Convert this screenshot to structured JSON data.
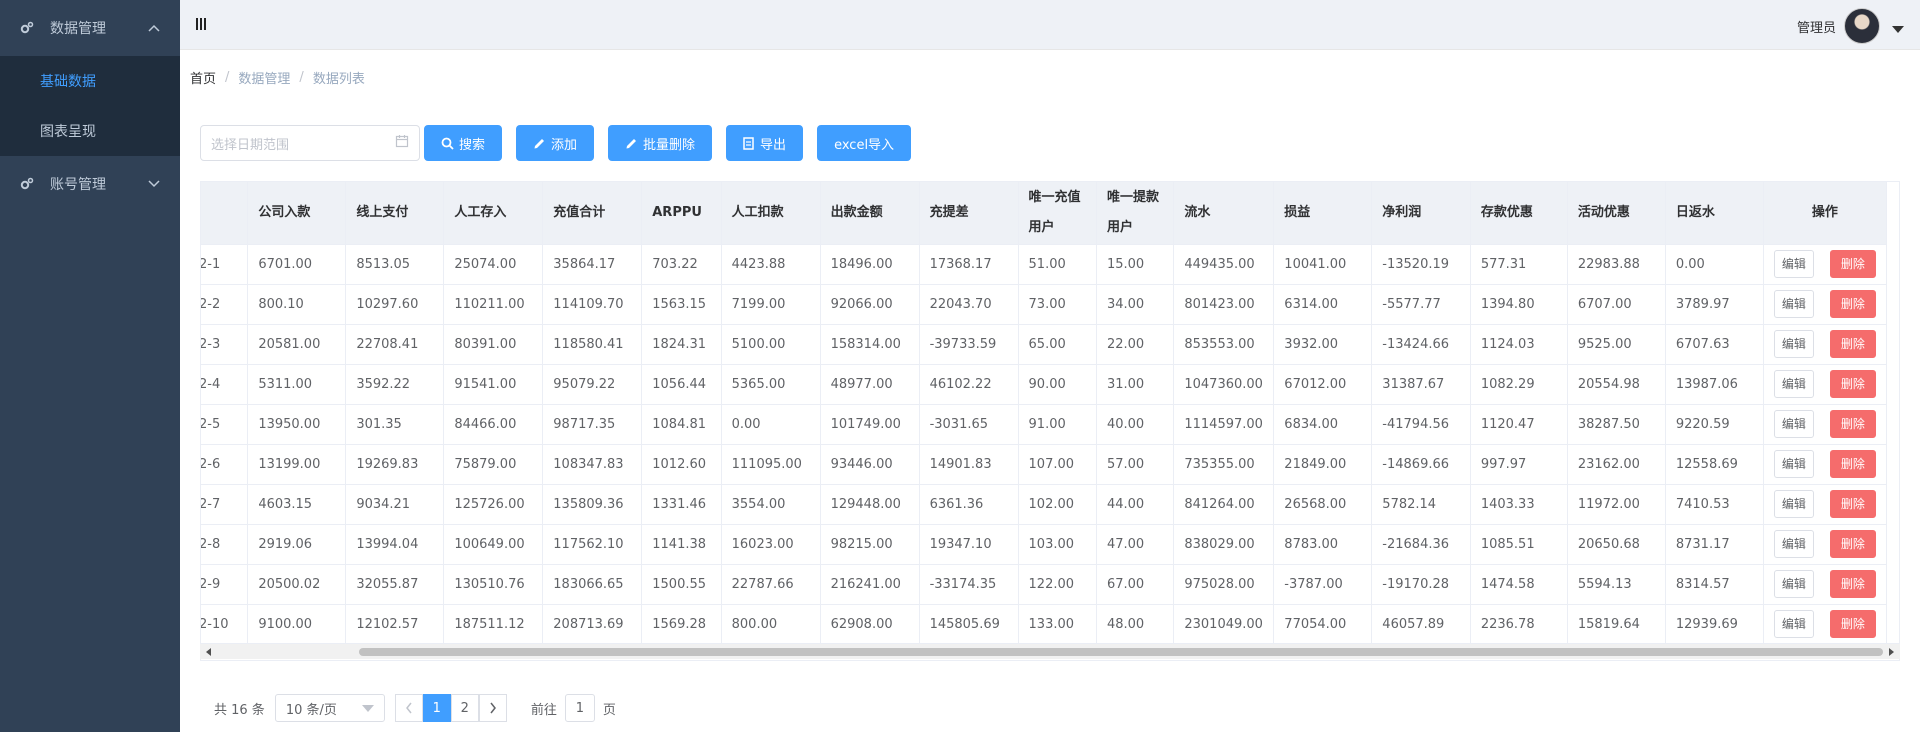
{
  "sidebar": {
    "menus": [
      {
        "label": "数据管理",
        "expanded": true,
        "icon": "cogs-icon",
        "items": [
          {
            "label": "基础数据",
            "active": true
          },
          {
            "label": "图表呈现",
            "active": false
          }
        ]
      },
      {
        "label": "账号管理",
        "expanded": false,
        "icon": "cogs-icon",
        "items": []
      }
    ]
  },
  "header": {
    "username": "管理员"
  },
  "breadcrumb": [
    "首页",
    "数据管理",
    "数据列表"
  ],
  "toolbar": {
    "date_placeholder": "选择日期范围",
    "search": "搜索",
    "add": "添加",
    "batch_delete": "批量删除",
    "export": "导出",
    "excel_import": "excel导入"
  },
  "table": {
    "columns": [
      "",
      "公司入款",
      "线上支付",
      "人工存入",
      "充值合计",
      "ARPPU",
      "人工扣款",
      "出款金额",
      "充提差",
      "唯一充值用户",
      "唯一提款用户",
      "流水",
      "损益",
      "净利润",
      "存款优惠",
      "活动优惠",
      "日返水",
      "操作"
    ],
    "edit_label": "编辑",
    "delete_label": "删除",
    "rows": [
      [
        "2-1",
        "6701.00",
        "8513.05",
        "25074.00",
        "35864.17",
        "703.22",
        "4423.88",
        "18496.00",
        "17368.17",
        "51.00",
        "15.00",
        "449435.00",
        "10041.00",
        "-13520.19",
        "577.31",
        "22983.88",
        "0.00"
      ],
      [
        "2-2",
        "800.10",
        "10297.60",
        "110211.00",
        "114109.70",
        "1563.15",
        "7199.00",
        "92066.00",
        "22043.70",
        "73.00",
        "34.00",
        "801423.00",
        "6314.00",
        "-5577.77",
        "1394.80",
        "6707.00",
        "3789.97"
      ],
      [
        "2-3",
        "20581.00",
        "22708.41",
        "80391.00",
        "118580.41",
        "1824.31",
        "5100.00",
        "158314.00",
        "-39733.59",
        "65.00",
        "22.00",
        "853553.00",
        "3932.00",
        "-13424.66",
        "1124.03",
        "9525.00",
        "6707.63"
      ],
      [
        "2-4",
        "5311.00",
        "3592.22",
        "91541.00",
        "95079.22",
        "1056.44",
        "5365.00",
        "48977.00",
        "46102.22",
        "90.00",
        "31.00",
        "1047360.00",
        "67012.00",
        "31387.67",
        "1082.29",
        "20554.98",
        "13987.06"
      ],
      [
        "2-5",
        "13950.00",
        "301.35",
        "84466.00",
        "98717.35",
        "1084.81",
        "0.00",
        "101749.00",
        "-3031.65",
        "91.00",
        "40.00",
        "1114597.00",
        "6834.00",
        "-41794.56",
        "1120.47",
        "38287.50",
        "9220.59"
      ],
      [
        "2-6",
        "13199.00",
        "19269.83",
        "75879.00",
        "108347.83",
        "1012.60",
        "111095.00",
        "93446.00",
        "14901.83",
        "107.00",
        "57.00",
        "735355.00",
        "21849.00",
        "-14869.66",
        "997.97",
        "23162.00",
        "12558.69"
      ],
      [
        "2-7",
        "4603.15",
        "9034.21",
        "125726.00",
        "135809.36",
        "1331.46",
        "3554.00",
        "129448.00",
        "6361.36",
        "102.00",
        "44.00",
        "841264.00",
        "26568.00",
        "5782.14",
        "1403.33",
        "11972.00",
        "7410.53"
      ],
      [
        "2-8",
        "2919.06",
        "13994.04",
        "100649.00",
        "117562.10",
        "1141.38",
        "16023.00",
        "98215.00",
        "19347.10",
        "103.00",
        "47.00",
        "838029.00",
        "8783.00",
        "-21684.36",
        "1085.51",
        "20650.68",
        "8731.17"
      ],
      [
        "2-9",
        "20500.02",
        "32055.87",
        "130510.76",
        "183066.65",
        "1500.55",
        "22787.66",
        "216241.00",
        "-33174.35",
        "122.00",
        "67.00",
        "975028.00",
        "-3787.00",
        "-19170.28",
        "1474.58",
        "5594.13",
        "8314.57"
      ],
      [
        "2-10",
        "9100.00",
        "12102.57",
        "187511.12",
        "208713.69",
        "1569.28",
        "800.00",
        "62908.00",
        "145805.69",
        "133.00",
        "48.00",
        "2301049.00",
        "77054.00",
        "46057.89",
        "2236.78",
        "15819.64",
        "12939.69"
      ]
    ]
  },
  "pagination": {
    "total_text": "共 16 条",
    "page_size": "10 条/页",
    "pages": [
      "1",
      "2"
    ],
    "current_page": "1",
    "goto_prefix": "前往",
    "goto_value": "1",
    "goto_suffix": "页"
  },
  "colors": {
    "primary": "#409eff",
    "danger": "#f56c6c",
    "sidebar": "#304156",
    "sidebar_sub": "#1f2d3d"
  }
}
